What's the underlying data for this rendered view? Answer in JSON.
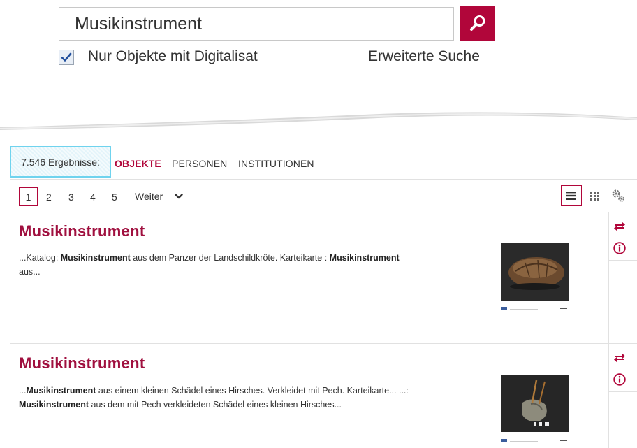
{
  "search": {
    "query": "Musikinstrument",
    "checkbox_label": "Nur Objekte mit Digitalisat",
    "checkbox_checked": true,
    "advanced_label": "Erweiterte Suche",
    "accent_color": "#b1063a"
  },
  "tabs": {
    "count": "7.546 Ergebnisse:",
    "items": [
      "OBJEKTE",
      "PERSONEN",
      "INSTITUTIONEN"
    ],
    "active": "OBJEKTE"
  },
  "pagination": {
    "pages": [
      "1",
      "2",
      "3",
      "4",
      "5"
    ],
    "current": "1",
    "next_label": "Weiter"
  },
  "view_options": [
    "list-view-icon",
    "grid-view-icon",
    "settings-gears-icon"
  ],
  "results": [
    {
      "title": "Musikinstrument",
      "snippet_parts": [
        {
          "t": "...Katalog: ",
          "b": false
        },
        {
          "t": "Musikinstrument",
          "b": true
        },
        {
          "t": " aus dem Panzer der Landschildkröte. Karteikarte : ",
          "b": false
        },
        {
          "t": "Musikinstrument",
          "b": true
        },
        {
          "t": " aus...",
          "b": false
        }
      ],
      "thumbnail": "tortoise-shell-photo"
    },
    {
      "title": "Musikinstrument",
      "snippet_parts": [
        {
          "t": "...",
          "b": false
        },
        {
          "t": "Musikinstrument",
          "b": true
        },
        {
          "t": " aus einem kleinen Schädel eines Hirsches. Verkleidet mit Pech. Karteikarte... ...: ",
          "b": false
        },
        {
          "t": "Musikinstrument",
          "b": true
        },
        {
          "t": " aus dem mit Pech verkleideten Schädel eines kleinen Hirsches...",
          "b": false
        }
      ],
      "thumbnail": "deer-skull-photo"
    }
  ],
  "result_actions": [
    "compare-arrows-icon",
    "info-icon"
  ]
}
